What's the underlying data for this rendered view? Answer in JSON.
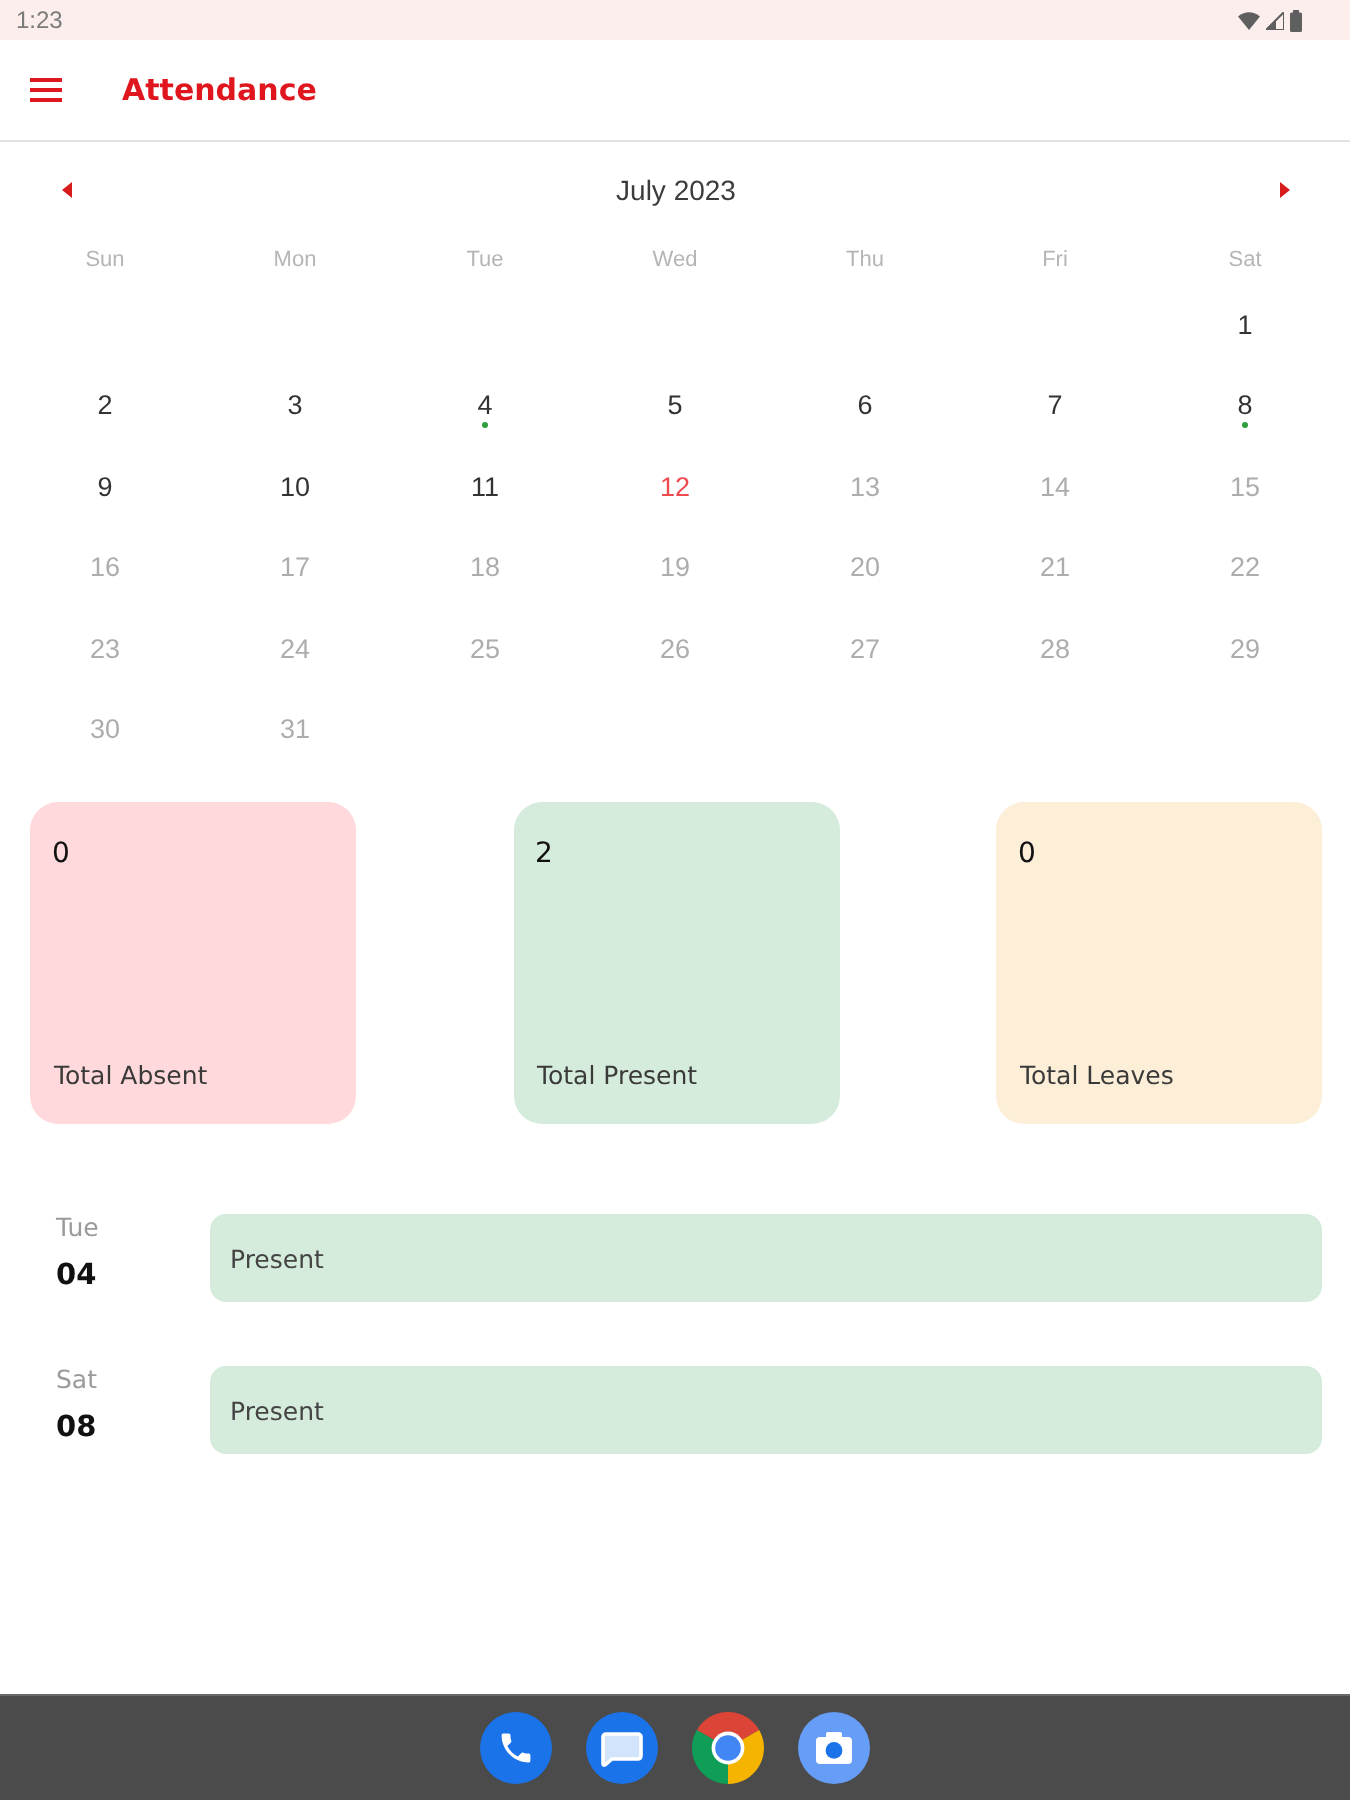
{
  "status_bar": {
    "time": "1:23"
  },
  "app_bar": {
    "title": "Attendance"
  },
  "calendar": {
    "month": "July 2023",
    "weekdays": [
      "Sun",
      "Mon",
      "Tue",
      "Wed",
      "Thu",
      "Fri",
      "Sat"
    ],
    "weeks": [
      [
        {
          "label": "1",
          "selected": false,
          "disabled": false,
          "marked": false
        }
      ],
      [
        {
          "label": "2",
          "selected": false,
          "disabled": false,
          "marked": false
        },
        {
          "label": "3",
          "selected": false,
          "disabled": false,
          "marked": false
        },
        {
          "label": "4",
          "selected": false,
          "disabled": false,
          "marked": true
        },
        {
          "label": "5",
          "selected": false,
          "disabled": false,
          "marked": false
        },
        {
          "label": "6",
          "selected": false,
          "disabled": false,
          "marked": false
        },
        {
          "label": "7",
          "selected": false,
          "disabled": false,
          "marked": false
        },
        {
          "label": "8",
          "selected": false,
          "disabled": false,
          "marked": true
        }
      ],
      [
        {
          "label": "9",
          "selected": false,
          "disabled": false,
          "marked": false
        },
        {
          "label": "10",
          "selected": false,
          "disabled": false,
          "marked": false
        },
        {
          "label": "11",
          "selected": false,
          "disabled": false,
          "marked": false
        },
        {
          "label": "12",
          "selected": true,
          "disabled": false,
          "marked": false
        },
        {
          "label": "13",
          "selected": false,
          "disabled": true,
          "marked": false
        },
        {
          "label": "14",
          "selected": false,
          "disabled": true,
          "marked": false
        },
        {
          "label": "15",
          "selected": false,
          "disabled": true,
          "marked": false
        }
      ],
      [
        {
          "label": "16",
          "selected": false,
          "disabled": true,
          "marked": false
        },
        {
          "label": "17",
          "selected": false,
          "disabled": true,
          "marked": false
        },
        {
          "label": "18",
          "selected": false,
          "disabled": true,
          "marked": false
        },
        {
          "label": "19",
          "selected": false,
          "disabled": true,
          "marked": false
        },
        {
          "label": "20",
          "selected": false,
          "disabled": true,
          "marked": false
        },
        {
          "label": "21",
          "selected": false,
          "disabled": true,
          "marked": false
        },
        {
          "label": "22",
          "selected": false,
          "disabled": true,
          "marked": false
        }
      ],
      [
        {
          "label": "23",
          "selected": false,
          "disabled": true,
          "marked": false
        },
        {
          "label": "24",
          "selected": false,
          "disabled": true,
          "marked": false
        },
        {
          "label": "25",
          "selected": false,
          "disabled": true,
          "marked": false
        },
        {
          "label": "26",
          "selected": false,
          "disabled": true,
          "marked": false
        },
        {
          "label": "27",
          "selected": false,
          "disabled": true,
          "marked": false
        },
        {
          "label": "28",
          "selected": false,
          "disabled": true,
          "marked": false
        },
        {
          "label": "29",
          "selected": false,
          "disabled": true,
          "marked": false
        }
      ],
      [
        {
          "label": "30",
          "selected": false,
          "disabled": true,
          "marked": false
        },
        {
          "label": "31",
          "selected": false,
          "disabled": true,
          "marked": false
        }
      ]
    ]
  },
  "summary_cards": [
    {
      "value": "0",
      "label": "Total Absent",
      "color": "#ffd9db"
    },
    {
      "value": "2",
      "label": "Total Present",
      "color": "#d5ebdc"
    },
    {
      "value": "0",
      "label": "Total Leaves",
      "color": "#fdeed8"
    }
  ],
  "records": [
    {
      "weekday": "Tue",
      "day": "04",
      "status": "Present",
      "color": "#d5ebdc"
    },
    {
      "weekday": "Sat",
      "day": "08",
      "status": "Present",
      "color": "#d5ebdc"
    }
  ]
}
